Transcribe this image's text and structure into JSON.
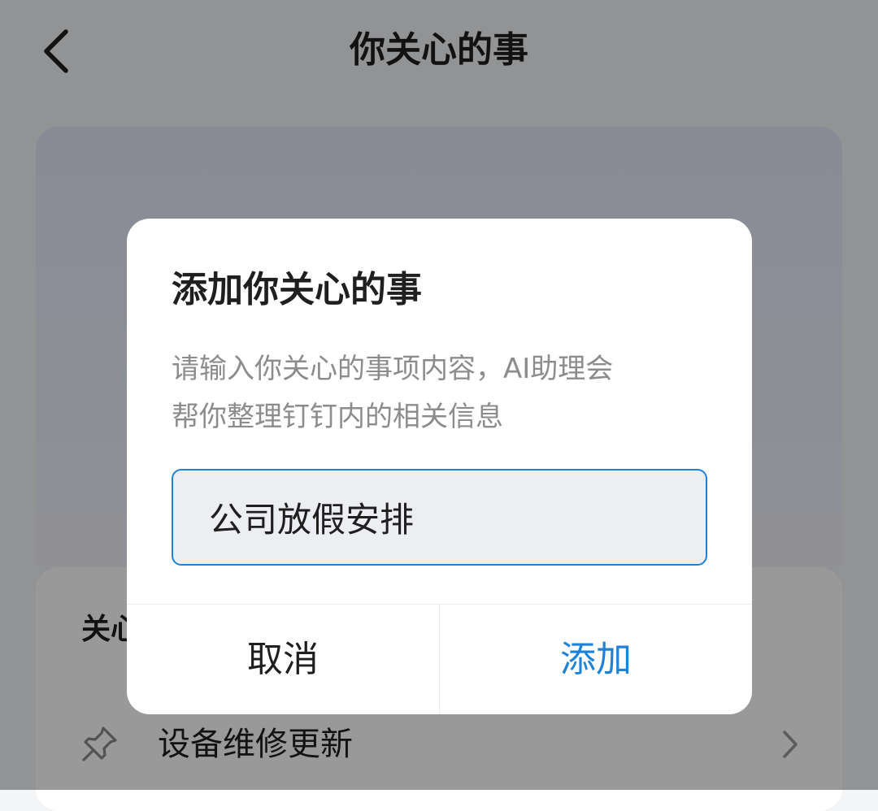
{
  "header": {
    "back_icon": "chevron-left-icon",
    "title": "你关心的事"
  },
  "list": {
    "section_label": "关心",
    "items": [
      {
        "label": "设备维修更新",
        "icon": "pin-icon",
        "trailing_icon": "chevron-right-icon"
      }
    ]
  },
  "dialog": {
    "title": "添加你关心的事",
    "description_line1": "请输入你关心的事项内容，AI助理会",
    "description_line2": "帮你整理钉钉内的相关信息",
    "input_value": "公司放假安排",
    "cancel_label": "取消",
    "confirm_label": "添加"
  },
  "colors": {
    "accent": "#1e82d9",
    "overlay": "rgba(0,0,0,0.40)",
    "muted_text": "#8c8c8c"
  }
}
